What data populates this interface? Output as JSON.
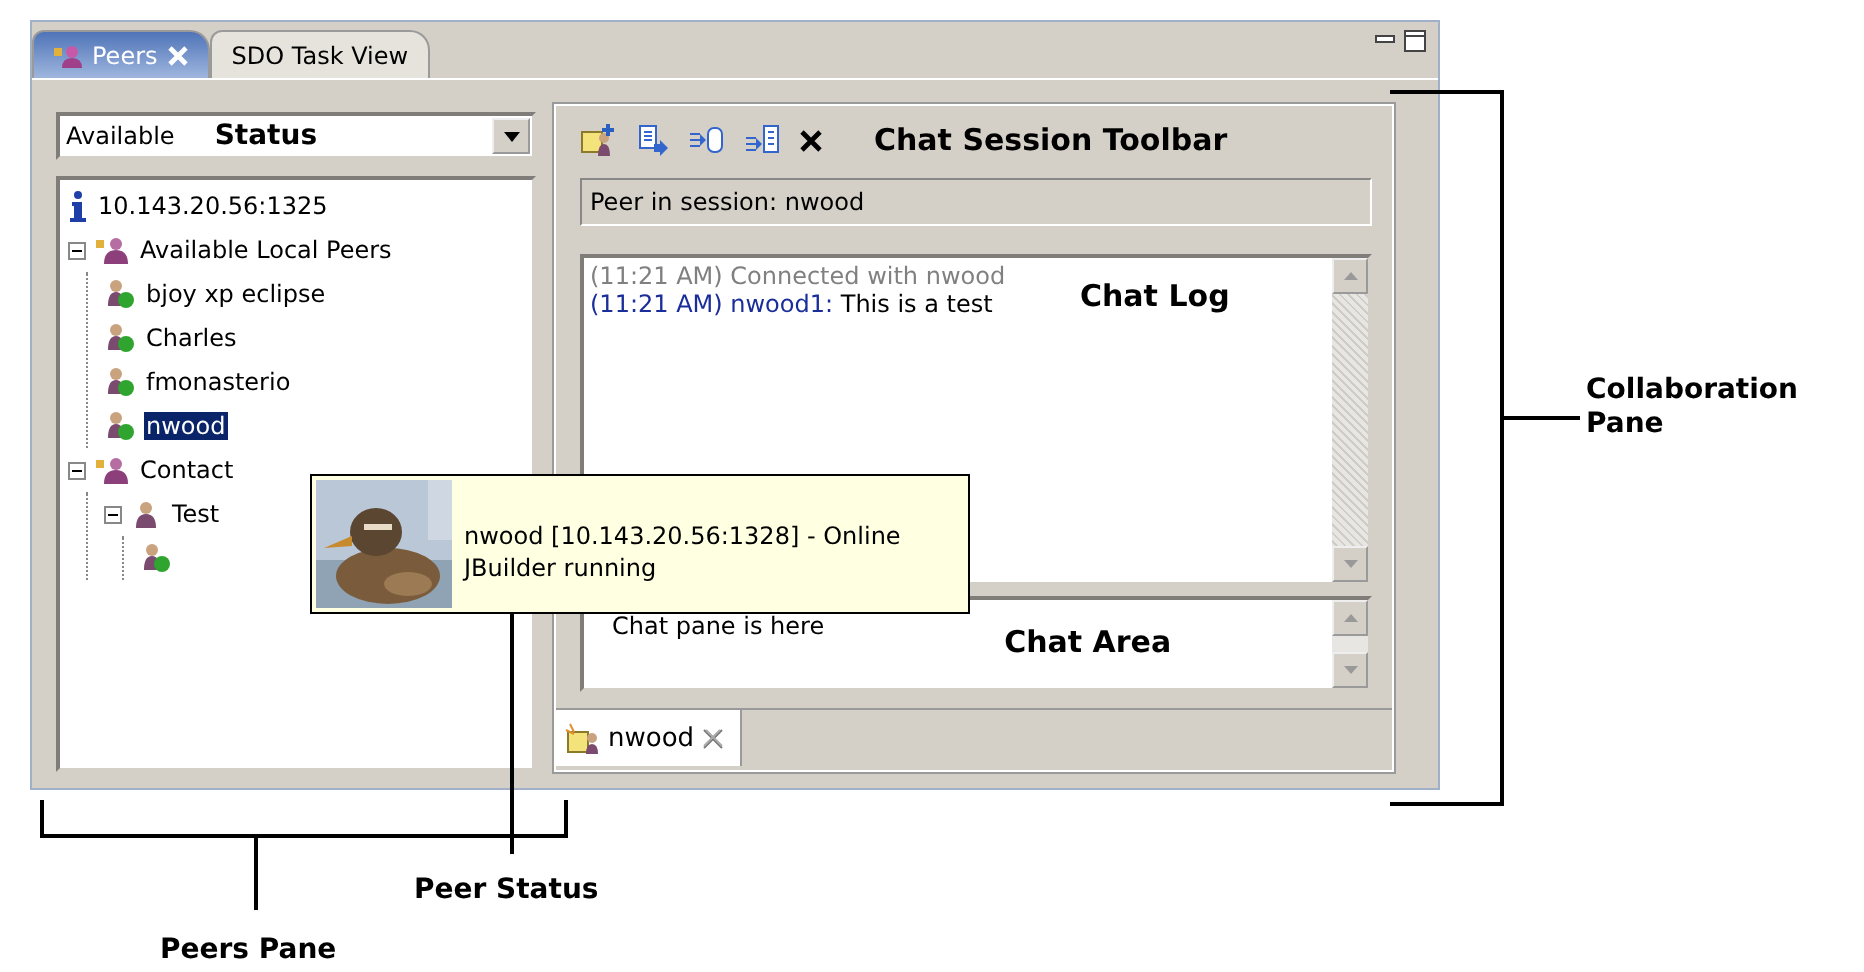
{
  "window": {
    "tabs": [
      {
        "label": "Peers",
        "selected": true,
        "closable": true
      },
      {
        "label": "SDO Task View",
        "selected": false,
        "closable": false
      }
    ]
  },
  "peers_pane": {
    "status": {
      "value": "Available",
      "callout": "Status"
    },
    "tree": [
      {
        "kind": "info",
        "label": "10.143.20.56:1325"
      },
      {
        "kind": "group",
        "label": "Available Local Peers",
        "expanded": true,
        "children": [
          {
            "kind": "peer",
            "label": "bjoy xp eclipse",
            "selected": false
          },
          {
            "kind": "peer",
            "label": "Charles",
            "selected": false
          },
          {
            "kind": "peer",
            "label": "fmonasterio",
            "selected": false
          },
          {
            "kind": "peer",
            "label": "nwood",
            "selected": true
          }
        ]
      },
      {
        "kind": "group",
        "label": "Contact",
        "expanded": true,
        "children": [
          {
            "kind": "contact",
            "label": "Test",
            "expanded": true,
            "children": [
              {
                "kind": "peer"
              }
            ]
          }
        ]
      }
    ]
  },
  "tooltip": {
    "lines": [
      "nwood [10.143.20.56:1328] - Online",
      "JBuilder running"
    ]
  },
  "collaboration_pane": {
    "toolbar": {
      "callout": "Chat Session Toolbar"
    },
    "peer_in_session": "Peer in session: nwood",
    "chat_log": {
      "callout": "Chat Log",
      "lines": [
        {
          "kind": "system",
          "text": "(11:21 AM) Connected with nwood"
        },
        {
          "kind": "message",
          "sender": "(11:21 AM) nwood1:",
          "text": "This is a test"
        }
      ]
    },
    "chat_area": {
      "value": "Chat pane is here",
      "callout": "Chat Area"
    },
    "session_tabs": [
      {
        "label": "nwood",
        "selected": true
      }
    ]
  },
  "annotations": [
    "Collaboration Pane",
    "Peer Status",
    "Peers Pane"
  ]
}
